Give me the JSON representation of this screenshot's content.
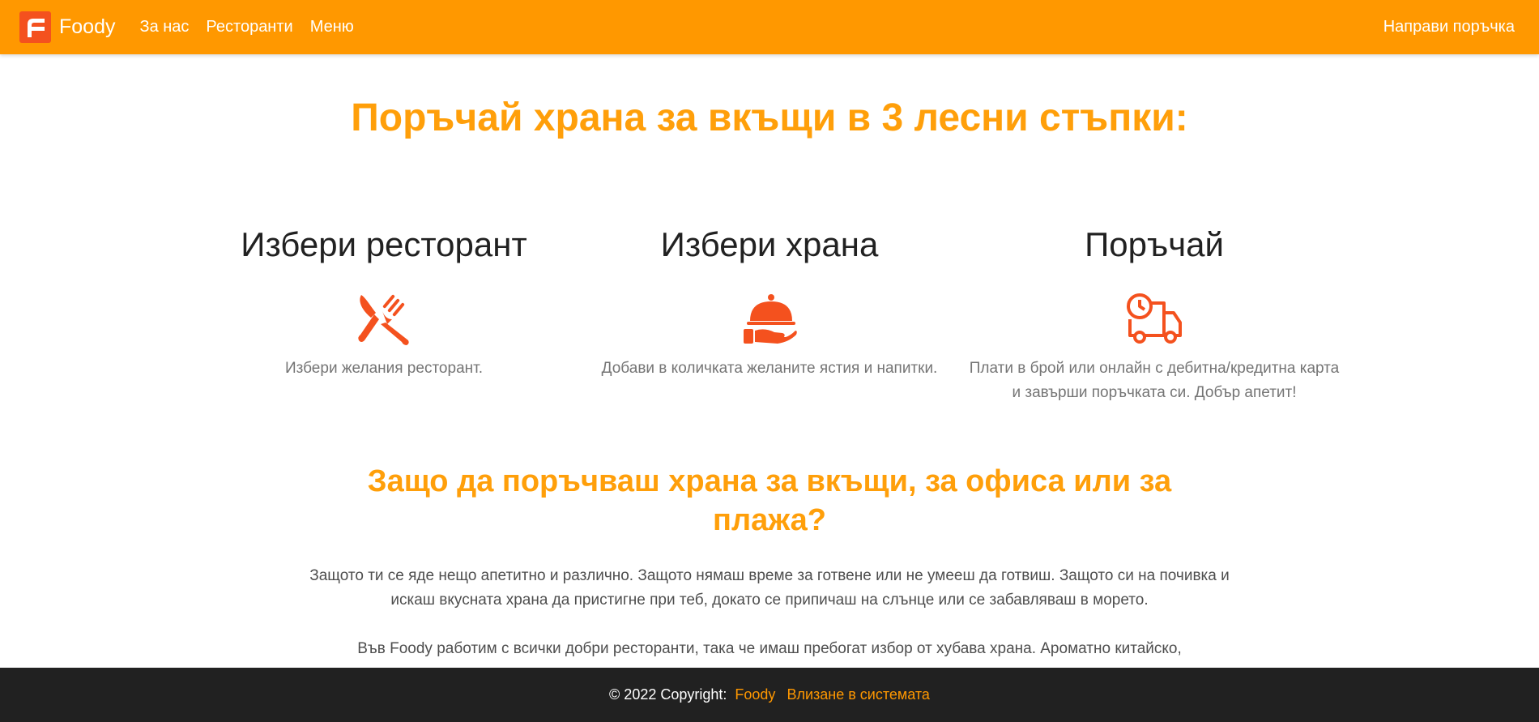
{
  "navbar": {
    "brand": "Foody",
    "logo_icon": "foody-logo-icon",
    "links": [
      "За нас",
      "Ресторанти",
      "Меню"
    ],
    "order_link": "Направи поръчка",
    "color": "#ff9800"
  },
  "hero": {
    "title": "Поръчай храна за вкъщи в 3 лесни стъпки:"
  },
  "steps": [
    {
      "title": "Избери ресторант",
      "icon": "utensils-icon",
      "text": "Избери желания ресторант."
    },
    {
      "title": "Избери храна",
      "icon": "cloche-hand-icon",
      "text": "Добави в количката желаните ястия и напитки."
    },
    {
      "title": "Поръчай",
      "icon": "delivery-truck-clock-icon",
      "text": "Плати в брой или онлайн с дебитна/кредитна карта и завърши поръчката си. Добър апетит!"
    }
  ],
  "why": {
    "title": "Защо да поръчваш храна за вкъщи, за офиса или за плажа?",
    "paragraphs": [
      "Защото ти се яде нещо апетитно и различно. Защото нямаш време за готвене или не умееш да готвиш. Защото си на почивка и искаш вкусната храна да пристигне при теб, докато се припичаш на слънце или се забавляваш в морето.",
      "Във Foody работим с всички добри ресторанти, така че имаш пребогат избор от хубава храна. Ароматно китайско,"
    ]
  },
  "footer": {
    "copyright": "© 2022 Copyright:",
    "brand_link": "Foody",
    "login_link": "Влизане в системата"
  },
  "colors": {
    "accent": "#ff9800",
    "title": "#ff9f0a",
    "icon": "#f4511e",
    "footer_bg": "#212121"
  }
}
